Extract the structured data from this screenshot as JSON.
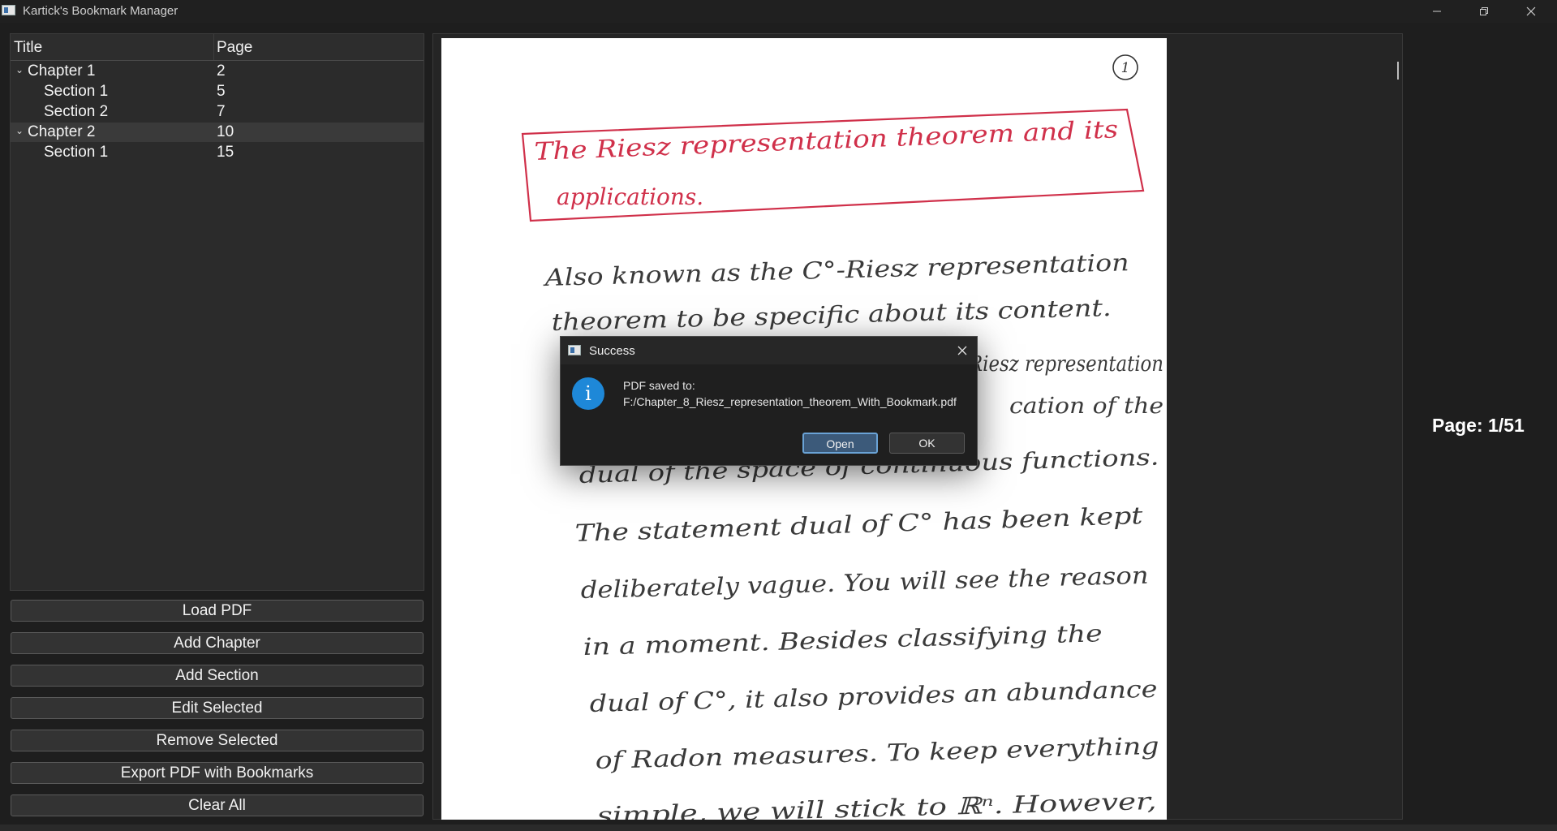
{
  "window": {
    "title": "Kartick's Bookmark Manager",
    "controls": [
      "minimize-icon",
      "restore-icon",
      "close-icon"
    ]
  },
  "tree": {
    "headers": {
      "title": "Title",
      "page": "Page"
    },
    "rows": [
      {
        "title": "Chapter 1",
        "page": "2",
        "expanded": true,
        "level": 0
      },
      {
        "title": "Section 1",
        "page": "5",
        "level": 1
      },
      {
        "title": "Section 2",
        "page": "7",
        "level": 1
      },
      {
        "title": "Chapter 2",
        "page": "10",
        "expanded": true,
        "level": 0,
        "selected": true
      },
      {
        "title": "Section 1",
        "page": "15",
        "level": 1
      }
    ],
    "chevron": "⌄"
  },
  "buttons": {
    "load_pdf": "Load PDF",
    "add_chapter": "Add Chapter",
    "add_section": "Add Section",
    "edit_selected": "Edit Selected",
    "remove_selected": "Remove Selected",
    "export_pdf": "Export PDF with Bookmarks",
    "clear_all": "Clear All"
  },
  "viewer": {
    "page_indicator": "Page: 1/51",
    "page_number_mark": "1",
    "heading_lines": [
      "The Riesz representation theorem and its",
      "applications."
    ],
    "body_lines": [
      "Also known as the C°-Riesz representation",
      "theorem to be specific about its content.",
      "Riesz representation",
      "cation of the",
      "dual of the space of continuous functions.",
      "The statement dual of C° has been kept",
      "deliberately vague. You will see the reason",
      "in a moment. Besides classifying the",
      "dual of C°, it also provides an abundance",
      "of Radon measures. To keep everything",
      "simple, we will stick to ℝⁿ. However,"
    ]
  },
  "dialog": {
    "title": "Success",
    "info_glyph": "i",
    "message_line1": "PDF saved to:",
    "message_line2": "F:/Chapter_8_Riesz_representation_theorem_With_Bookmark.pdf",
    "open_label": "Open",
    "ok_label": "OK"
  },
  "colors": {
    "background": "#1e1e1e",
    "panel": "#2b2b2b",
    "heading_ink": "#d0304a",
    "body_ink": "#3a3a3a",
    "info_blue": "#1e88d8",
    "open_focus": "#6aa3d6"
  }
}
